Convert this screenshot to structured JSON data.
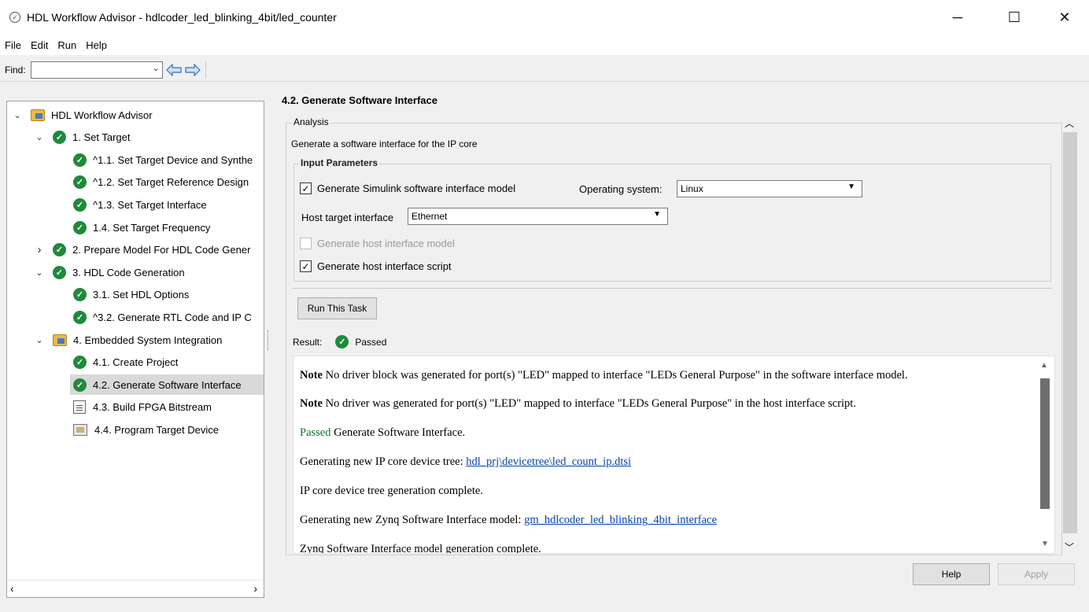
{
  "window": {
    "title": "HDL Workflow Advisor - hdlcoder_led_blinking_4bit/led_counter"
  },
  "menu": [
    "File",
    "Edit",
    "Run",
    "Help"
  ],
  "find": {
    "label": "Find:",
    "value": ""
  },
  "tree": [
    {
      "label": "HDL Workflow Advisor",
      "indent": 0,
      "chevron": "expanded",
      "icon": "folder"
    },
    {
      "label": "1. Set Target",
      "indent": 1,
      "chevron": "expanded",
      "icon": "check"
    },
    {
      "label": "^1.1. Set Target Device and Synthe",
      "indent": 2,
      "chevron": "",
      "icon": "check"
    },
    {
      "label": "^1.2. Set Target Reference Design",
      "indent": 2,
      "chevron": "",
      "icon": "check"
    },
    {
      "label": "^1.3. Set Target Interface",
      "indent": 2,
      "chevron": "",
      "icon": "check"
    },
    {
      "label": "1.4. Set Target Frequency",
      "indent": 2,
      "chevron": "",
      "icon": "check"
    },
    {
      "label": "2. Prepare Model For HDL Code Gener",
      "indent": 1,
      "chevron": "collapsed",
      "icon": "check"
    },
    {
      "label": "3. HDL Code Generation",
      "indent": 1,
      "chevron": "expanded",
      "icon": "check"
    },
    {
      "label": "3.1. Set HDL Options",
      "indent": 2,
      "chevron": "",
      "icon": "check"
    },
    {
      "label": "^3.2. Generate RTL Code and IP C",
      "indent": 2,
      "chevron": "",
      "icon": "check"
    },
    {
      "label": "4. Embedded System Integration",
      "indent": 1,
      "chevron": "expanded",
      "icon": "folder"
    },
    {
      "label": "4.1. Create Project",
      "indent": 2,
      "chevron": "",
      "icon": "check"
    },
    {
      "label": "4.2. Generate Software Interface",
      "indent": 2,
      "chevron": "",
      "icon": "check",
      "selected": true
    },
    {
      "label": "4.3. Build FPGA Bitstream",
      "indent": 2,
      "chevron": "",
      "icon": "doc"
    },
    {
      "label": "4.4. Program Target Device",
      "indent": 2,
      "chevron": "",
      "icon": "program"
    }
  ],
  "panel": {
    "title": "4.2. Generate Software Interface",
    "analysis_label": "Analysis",
    "description": "Generate a software interface for the IP core",
    "input_params_label": "Input Parameters",
    "gen_simulink": {
      "label": "Generate Simulink software interface model",
      "checked": true
    },
    "os_label": "Operating system:",
    "os_value": "Linux",
    "host_if_label": "Host target interface",
    "host_if_value": "Ethernet",
    "gen_host_model": {
      "label": "Generate host interface model",
      "checked": false,
      "enabled": false
    },
    "gen_host_script": {
      "label": "Generate host interface script",
      "checked": true
    },
    "run_button": "Run This Task",
    "result_label": "Result:",
    "result_value": "Passed"
  },
  "log": {
    "line1_note": "Note",
    "line1_text": " No driver block was generated for port(s) \"LED\" mapped to interface \"LEDs General Purpose\" in the software interface model.",
    "line2_note": "Note",
    "line2_text": " No driver was generated for port(s) \"LED\" mapped to interface \"LEDs General Purpose\" in the host interface script.",
    "line3_status": "Passed",
    "line3_text": " Generate Software Interface.",
    "line4_text": "Generating new IP core device tree: ",
    "line4_link": "hdl_prj\\devicetree\\led_count_ip.dtsi",
    "line5_text": "IP core device tree generation complete.",
    "line6_text": "Generating new Zynq Software Interface model: ",
    "line6_link": "gm_hdlcoder_led_blinking_4bit_interface",
    "line7_text": "Zynq Software Interface model generation complete."
  },
  "buttons": {
    "help": "Help",
    "apply": "Apply"
  },
  "colors": {
    "check_green": "#1f8a3a",
    "passed_text": "#0b7a2b",
    "link": "#0645ad",
    "selection": "#d9d9d9"
  }
}
